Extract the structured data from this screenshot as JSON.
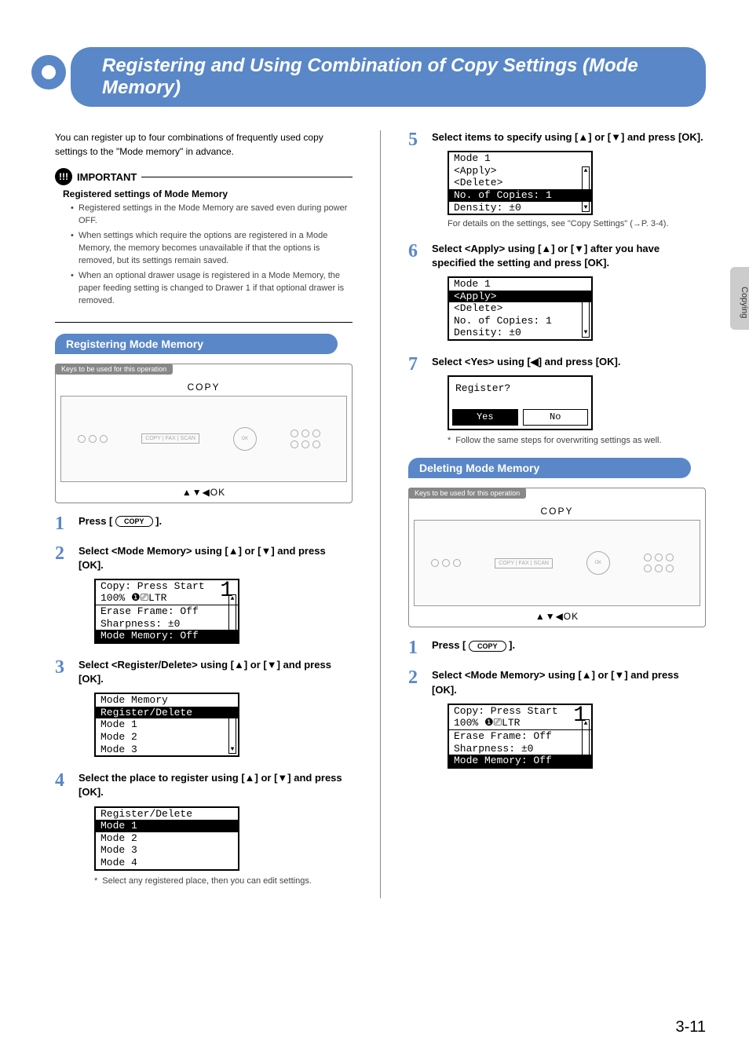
{
  "banner": {
    "title": "Registering and Using Combination of Copy Settings (Mode Memory)"
  },
  "intro": "You can register up to four combinations of frequently used copy settings to the \"Mode memory\" in advance.",
  "important": {
    "label": "IMPORTANT",
    "subtitle": "Registered settings of Mode Memory",
    "items": [
      "Registered settings in the Mode Memory are saved even during power OFF.",
      "When settings which require the options are registered in a Mode Memory, the memory becomes unavailable if that the options is removed, but its settings remain saved.",
      "When an optional drawer usage is registered in a Mode Memory, the paper feeding setting is changed to Drawer 1 if that optional drawer is removed."
    ]
  },
  "section_register": {
    "title": "Registering Mode Memory",
    "keys_label": "Keys to be used for this operation",
    "panel_caption": "COPY",
    "panel_keys": "▲▼◀OK"
  },
  "section_delete": {
    "title": "Deleting Mode Memory",
    "keys_label": "Keys to be used for this operation",
    "panel_caption": "COPY",
    "panel_keys": "▲▼◀OK"
  },
  "steps_left": {
    "s1": {
      "text_a": "Press [ ",
      "key": "COPY",
      "text_b": " ]."
    },
    "s2": {
      "text": "Select <Mode Memory> using [▲] or [▼] and press [OK]."
    },
    "s2_lcd": {
      "l1": "Copy: Press Start",
      "l2": "100% ❶⎚LTR",
      "big": "1",
      "l3": "Erase Frame: Off",
      "l4": "Sharpness: ±0",
      "l5": "Mode Memory: Off"
    },
    "s3": {
      "text": "Select <Register/Delete> using [▲] or [▼] and press [OK]."
    },
    "s3_lcd": {
      "l1": "Mode Memory",
      "l2": "Register/Delete",
      "l3": "Mode 1",
      "l4": "Mode 2",
      "l5": "Mode 3"
    },
    "s4": {
      "text": "Select the place to register using [▲] or [▼] and press [OK]."
    },
    "s4_lcd": {
      "l1": "Register/Delete",
      "l2": "Mode 1",
      "l3": "Mode 2",
      "l4": "Mode 3",
      "l5": "Mode 4"
    },
    "s4_note": "Select any registered place, then you can edit settings."
  },
  "steps_right": {
    "s5": {
      "text": "Select items to specify using [▲] or [▼] and press [OK]."
    },
    "s5_lcd": {
      "l1": "Mode 1",
      "l2": "<Apply>",
      "l3": "<Delete>",
      "l4": "No. of Copies: 1",
      "l5": "Density: ±0"
    },
    "s5_note": "For details on the settings, see \"Copy Settings\" (→P. 3-4).",
    "s6": {
      "text": "Select <Apply> using [▲] or [▼] after you have specified the setting and press [OK]."
    },
    "s6_lcd": {
      "l1": "Mode 1",
      "l2": "<Apply>",
      "l3": "<Delete>",
      "l4": "No. of Copies: 1",
      "l5": "Density: ±0"
    },
    "s7": {
      "text": "Select <Yes> using [◀] and press [OK]."
    },
    "s7_lcd": {
      "title": "Register?",
      "yes": "Yes",
      "no": "No"
    },
    "s7_note": "Follow the same steps for overwriting settings as well.",
    "d1": {
      "text_a": "Press [ ",
      "key": "COPY",
      "text_b": " ]."
    },
    "d2": {
      "text": "Select <Mode Memory> using [▲] or [▼] and press [OK]."
    },
    "d2_lcd": {
      "l1": "Copy: Press Start",
      "l2": "100% ❶⎚LTR",
      "big": "1",
      "l3": "Erase Frame: Off",
      "l4": "Sharpness: ±0",
      "l5": "Mode Memory: Off"
    }
  },
  "side_tab": "Copying",
  "page_number": "3-11"
}
